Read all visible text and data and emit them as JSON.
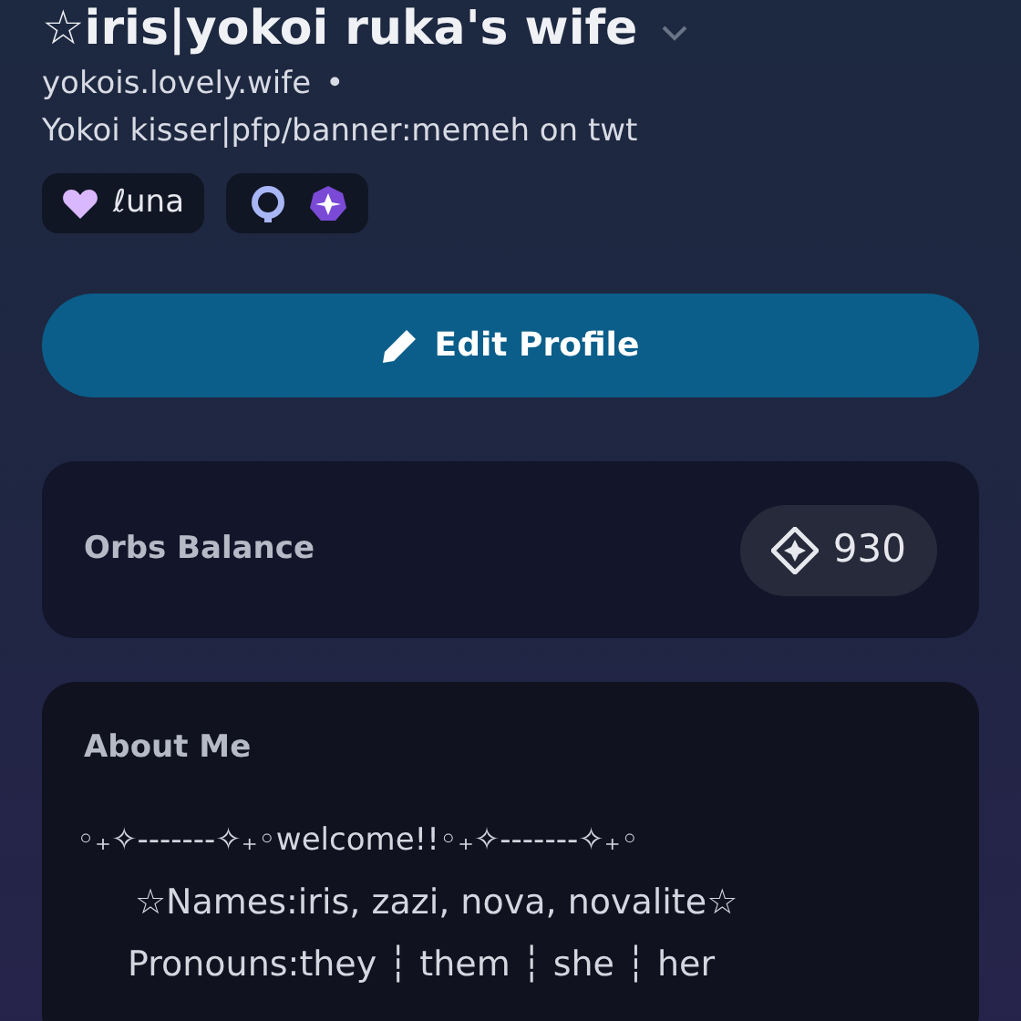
{
  "profile": {
    "display_name": "☆iris|yokoi ruka's wife",
    "username": "yokois.lovely.wife",
    "separator": "•",
    "bio": "Yokoi kisser|pfp/banner:memeh on twt"
  },
  "tags": [
    {
      "kind": "clan",
      "label": "ℓuna"
    },
    {
      "kind": "badges"
    }
  ],
  "edit_button": {
    "label": "Edit Profile"
  },
  "orbs": {
    "label": "Orbs Balance",
    "amount": "930"
  },
  "about": {
    "heading": "About Me",
    "lines": [
      "◦₊✧-------✧₊◦welcome!!◦₊✧-------✧₊◦",
      "☆Names:iris, zazi, nova, novalite☆",
      "Pronouns:they ┆ them ┆ she ┆ her"
    ]
  }
}
